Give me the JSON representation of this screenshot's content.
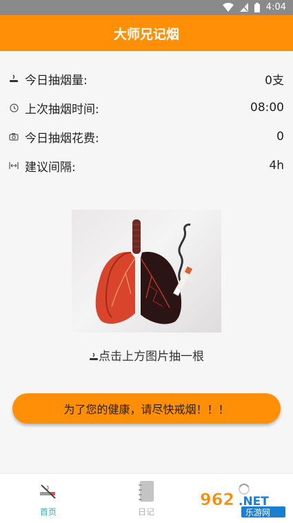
{
  "status_bar": {
    "time": "4:04"
  },
  "app_bar": {
    "title": "大师兄记烟"
  },
  "stats": [
    {
      "icon": "cigarette-icon",
      "label": "今日抽烟量:",
      "value": "0支"
    },
    {
      "icon": "clock-icon",
      "label": "上次抽烟时间:",
      "value": "08:00"
    },
    {
      "icon": "camera-icon",
      "label": "今日抽烟花费:",
      "value": "0"
    },
    {
      "icon": "interval-icon",
      "label": "建议间隔:",
      "value": "4h"
    }
  ],
  "tap_hint": {
    "text": "点击上方图片抽一根"
  },
  "warning": {
    "text": "为了您的健康，请尽快戒烟！！！"
  },
  "bottom_nav": [
    {
      "icon": "no-smoking-icon",
      "label": "首页",
      "active": true
    },
    {
      "icon": "notebook-icon",
      "label": "日记",
      "active": false
    },
    {
      "icon": "profile-icon",
      "label": "",
      "active": false
    }
  ],
  "colors": {
    "primary": "#ff8f06",
    "active_tab": "#1fb5b5",
    "inactive_tab": "#b0b0b0"
  },
  "watermark": {
    "brand": "962.NET",
    "sub": "乐游网"
  }
}
